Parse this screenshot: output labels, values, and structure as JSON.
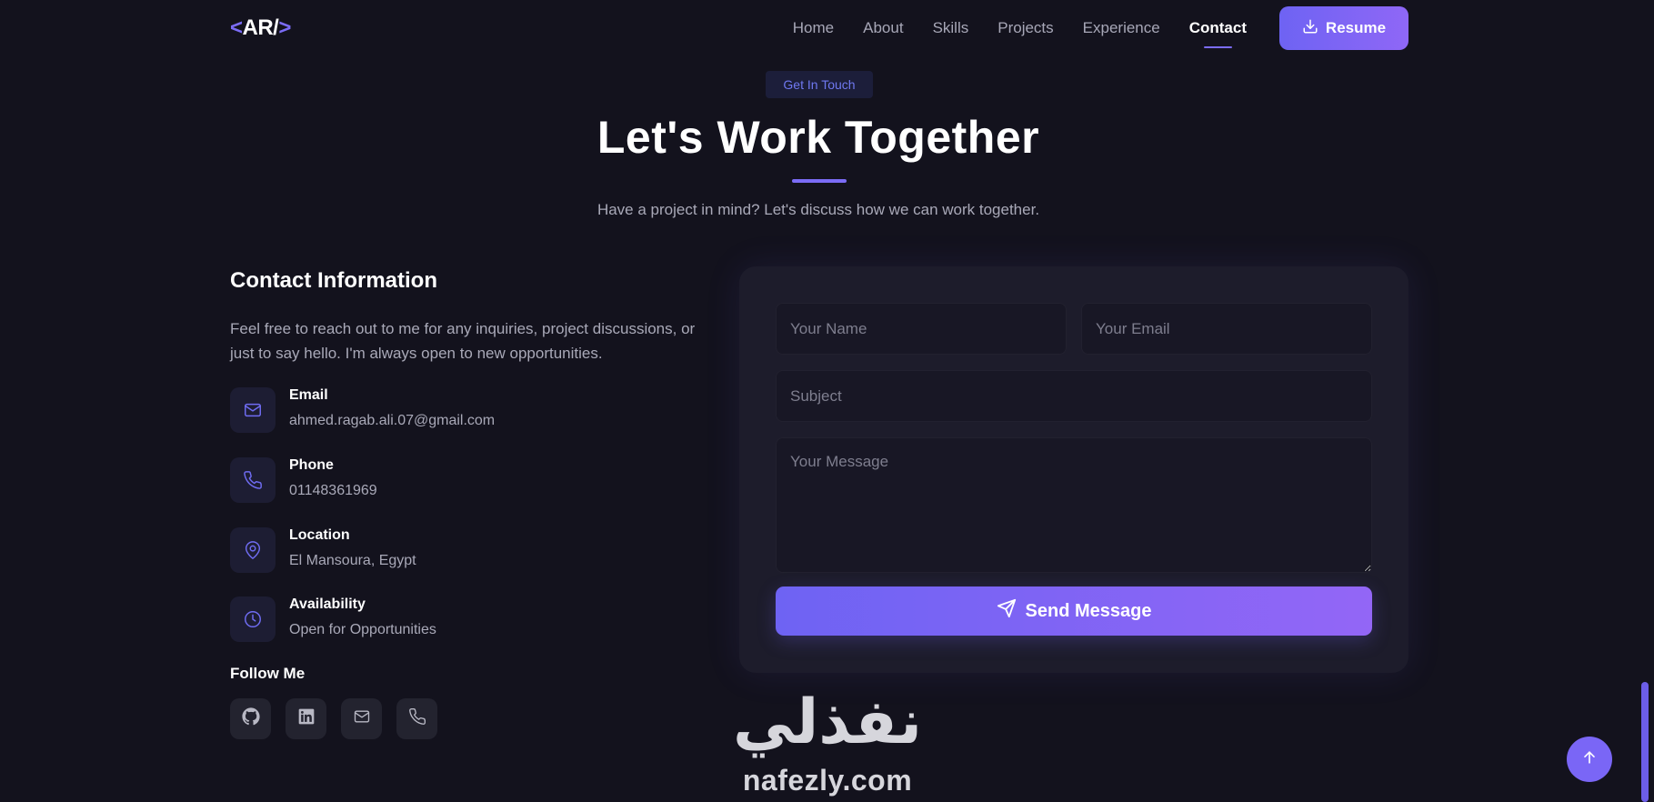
{
  "nav": {
    "logo": {
      "open": "<",
      "mid": "AR/",
      "close": ">"
    },
    "links": [
      "Home",
      "About",
      "Skills",
      "Projects",
      "Experience",
      "Contact"
    ],
    "active": "Contact",
    "resume_label": "Resume"
  },
  "header": {
    "pill": "Get In Touch",
    "title": "Let's Work Together",
    "subtitle": "Have a project in mind? Let's discuss how we can work together."
  },
  "contact": {
    "heading": "Contact Information",
    "description": "Feel free to reach out to me for any inquiries, project discussions, or just to say hello. I'm always open to new opportunities.",
    "items": [
      {
        "label": "Email",
        "value": "ahmed.ragab.ali.07@gmail.com",
        "icon": "mail-icon"
      },
      {
        "label": "Phone",
        "value": "01148361969",
        "icon": "phone-icon"
      },
      {
        "label": "Location",
        "value": "El Mansoura, Egypt",
        "icon": "map-pin-icon"
      },
      {
        "label": "Availability",
        "value": "Open for Opportunities",
        "icon": "clock-icon"
      }
    ],
    "follow_heading": "Follow Me",
    "socials": [
      "github-icon",
      "linkedin-icon",
      "mail-icon",
      "phone-icon"
    ]
  },
  "form": {
    "name_placeholder": "Your Name",
    "email_placeholder": "Your Email",
    "subject_placeholder": "Subject",
    "message_placeholder": "Your Message",
    "send_label": "Send Message"
  },
  "watermark": {
    "arabic": "نفذلي",
    "latin": "nafezly.com"
  },
  "colors": {
    "accent": "#7b6cf6",
    "background": "#13121d",
    "card": "#1d1c2b"
  }
}
